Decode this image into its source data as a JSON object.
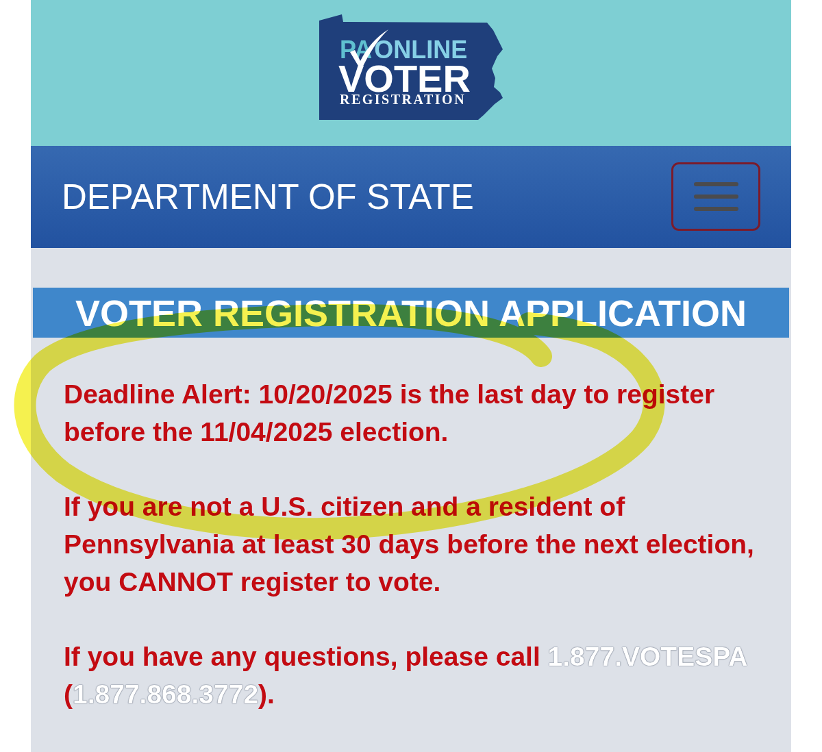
{
  "logo": {
    "state": "PA",
    "tagline": "ONLINE",
    "title": "VOTER",
    "subtitle": "REGISTRATION"
  },
  "navbar": {
    "title": "DEPARTMENT OF STATE"
  },
  "heading": "VOTER REGISTRATION APPLICATION",
  "paragraphs": [
    {
      "parts": [
        {
          "kind": "text",
          "text": "Deadline Alert: 10/20/2025 is the last day to register before the 11/04/2025 election."
        }
      ]
    },
    {
      "parts": [
        {
          "kind": "text",
          "text": "If you are not a U.S. citizen and a resident of Pennsylvania at least 30 days before the next election, you CANNOT register to vote."
        }
      ]
    },
    {
      "parts": [
        {
          "kind": "text",
          "text": "If you have any questions, please call "
        },
        {
          "kind": "link",
          "text": "1.877.VOTESPA"
        },
        {
          "kind": "text",
          "text": " ("
        },
        {
          "kind": "link",
          "text": "1.877.868.3772"
        },
        {
          "kind": "text",
          "text": ")."
        }
      ]
    }
  ]
}
